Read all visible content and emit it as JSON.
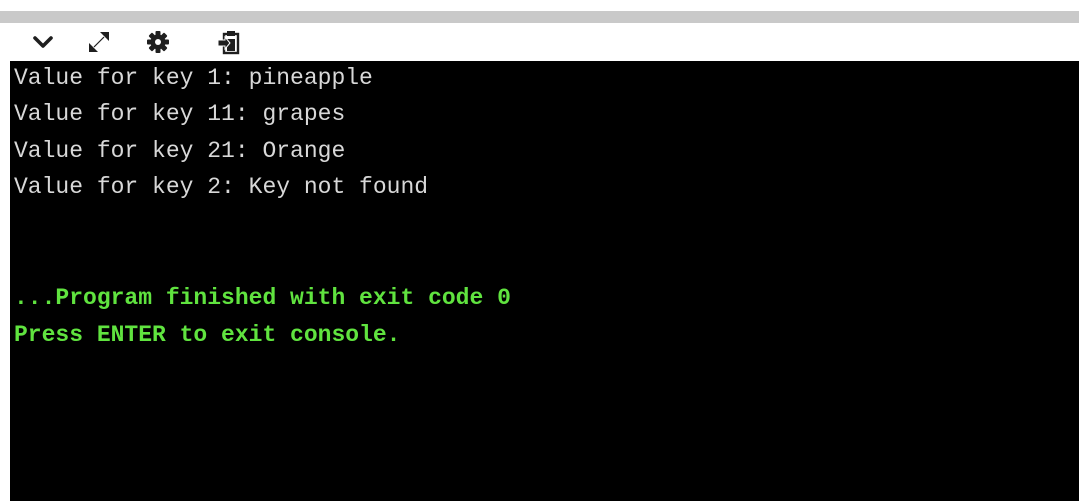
{
  "toolbar": {
    "buttons": [
      {
        "id": "collapse",
        "icon": "chevron-down-icon"
      },
      {
        "id": "expand",
        "icon": "expand-arrows-icon"
      },
      {
        "id": "settings",
        "icon": "gear-icon"
      },
      {
        "id": "clipboard",
        "icon": "clipboard-icon"
      }
    ]
  },
  "console": {
    "output_lines": [
      "Value for key 1: pineapple",
      "Value for key 11: grapes",
      "Value for key 21: Orange",
      "Value for key 2: Key not found"
    ],
    "status_lines": [
      "...Program finished with exit code 0",
      "Press ENTER to exit console."
    ]
  },
  "colors": {
    "console_background": "#000000",
    "output_text": "#d8d8d8",
    "status_text": "#60e33f",
    "toolbar_strip": "#c9c9c9"
  }
}
